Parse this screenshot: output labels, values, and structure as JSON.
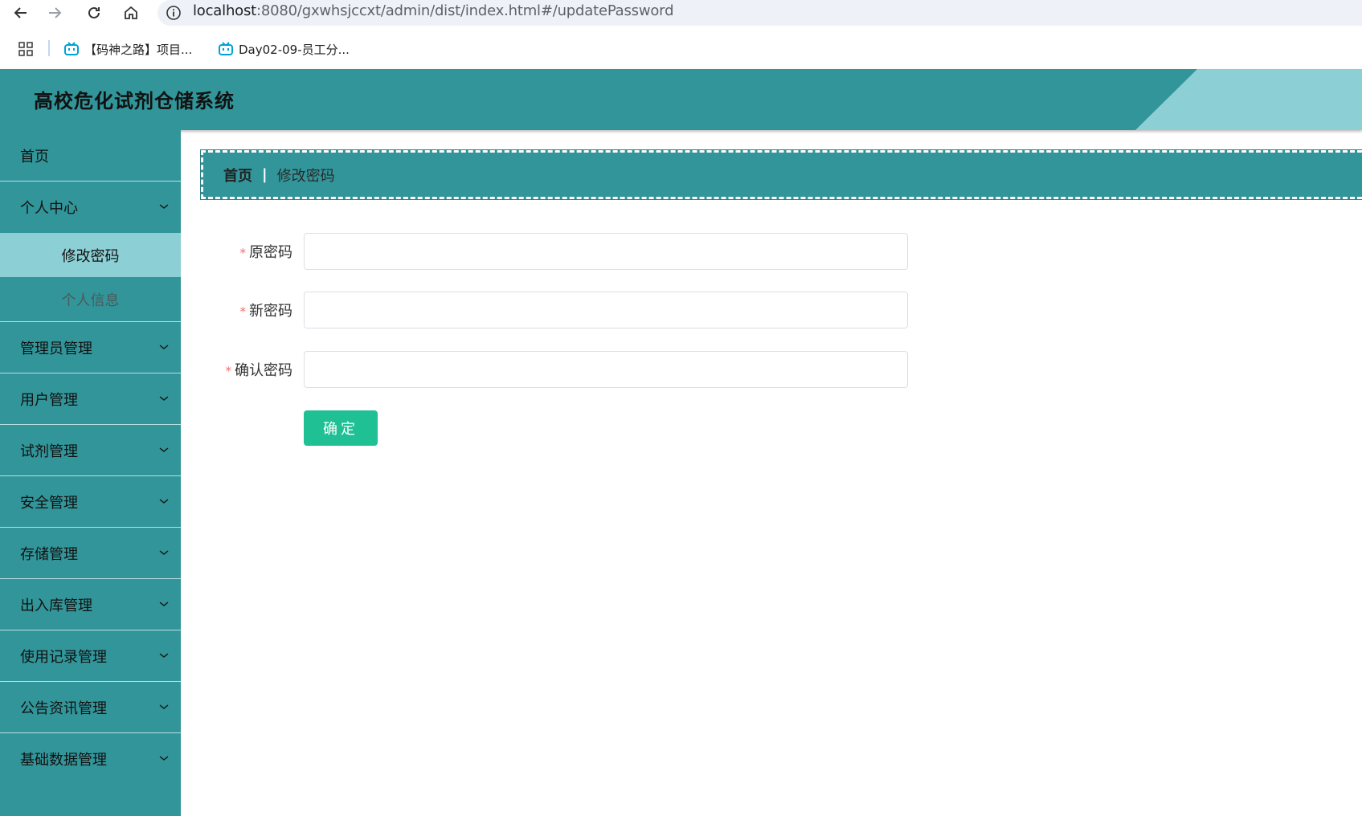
{
  "browser": {
    "url_host": "localhost",
    "url_rest": ":8080/gxwhsjccxt/admin/dist/index.html#/updatePassword",
    "bookmarks": [
      {
        "label": "【码神之路】项目..."
      },
      {
        "label": "Day02-09-员工分..."
      }
    ]
  },
  "app": {
    "title": "高校危化试剂仓储系统"
  },
  "sidebar": {
    "items": [
      {
        "label": "首页",
        "has_children": false
      },
      {
        "label": "个人中心",
        "has_children": true
      },
      {
        "label": "管理员管理",
        "has_children": true
      },
      {
        "label": "用户管理",
        "has_children": true
      },
      {
        "label": "试剂管理",
        "has_children": true
      },
      {
        "label": "安全管理",
        "has_children": true
      },
      {
        "label": "存储管理",
        "has_children": true
      },
      {
        "label": "出入库管理",
        "has_children": true
      },
      {
        "label": "使用记录管理",
        "has_children": true
      },
      {
        "label": "公告资讯管理",
        "has_children": true
      },
      {
        "label": "基础数据管理",
        "has_children": true
      }
    ],
    "personal_center_children": [
      {
        "label": "修改密码",
        "active": true
      },
      {
        "label": "个人信息",
        "active": false
      }
    ]
  },
  "breadcrumb": {
    "home": "首页",
    "separator": "|",
    "current": "修改密码"
  },
  "form": {
    "required_mark": "*",
    "fields": [
      {
        "label": "原密码",
        "value": ""
      },
      {
        "label": "新密码",
        "value": ""
      },
      {
        "label": "确认密码",
        "value": ""
      }
    ],
    "submit_label": "确定"
  },
  "colors": {
    "primary_teal": "#329599",
    "light_teal": "#8ccfd5",
    "submit_green": "#1fc094",
    "required_red": "#f56c6c"
  },
  "icons": {
    "back": "arrow-left-icon",
    "forward": "arrow-right-icon",
    "reload": "reload-icon",
    "home": "home-icon",
    "site_info": "info-icon",
    "apps": "apps-grid-icon",
    "bookmark": "bilibili-tv-icon",
    "expand": "chevron-down-icon"
  }
}
